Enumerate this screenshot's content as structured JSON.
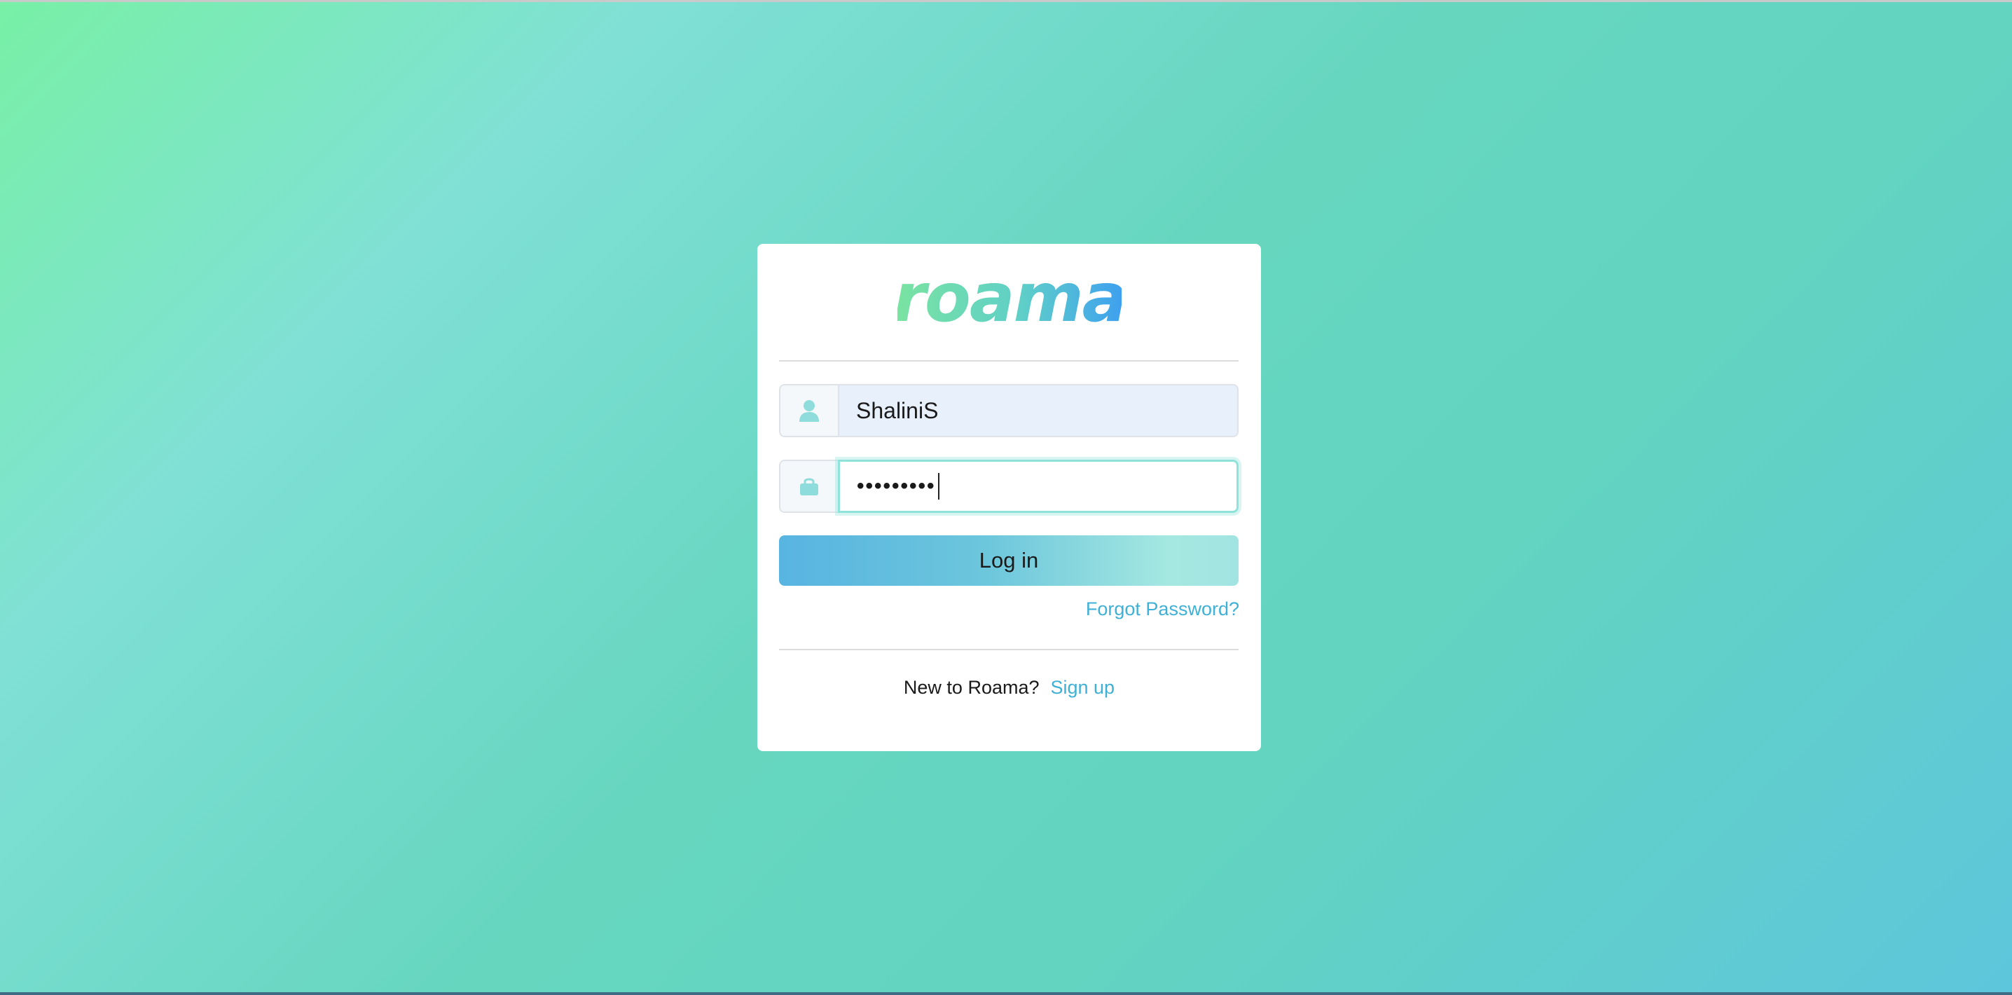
{
  "brand": {
    "logo_text": "roama",
    "gradient_start": "#7ae4a0",
    "gradient_end": "#3d9ff0"
  },
  "login_form": {
    "username": {
      "icon": "user-icon",
      "value": "ShaliniS"
    },
    "password": {
      "icon": "lock-icon",
      "masked_value": "•••••••••"
    },
    "submit_label": "Log in",
    "forgot_password_label": "Forgot Password?"
  },
  "signup": {
    "prompt": "New to Roama?",
    "link_label": "Sign up"
  },
  "colors": {
    "accent": "#3fb1d6",
    "icon": "#8edcdb",
    "button_gradient_start": "#58b4e1",
    "button_gradient_end": "#a5e8e1"
  }
}
